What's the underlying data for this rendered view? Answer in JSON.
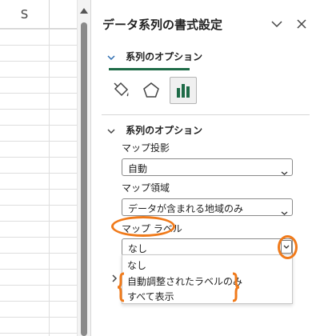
{
  "sheet": {
    "column_header": "S"
  },
  "pane": {
    "title": "データ系列の書式設定",
    "tab_label": "系列のオプション",
    "section_label": "系列のオプション",
    "accent_color": "#1e6b47",
    "annotation_color": "#f07a1a",
    "category_icons": [
      "fill-bucket-icon",
      "pentagon-icon",
      "bar-chart-icon"
    ],
    "fields": [
      {
        "label": "マップ投影",
        "value": "自動"
      },
      {
        "label": "マップ領域",
        "value": "データが含まれる地域のみ"
      },
      {
        "label": "マップ ラベル",
        "value": "なし"
      }
    ],
    "dropdown_options": [
      "なし",
      "自動調整されたラベルのみ",
      "すべて表示"
    ]
  }
}
